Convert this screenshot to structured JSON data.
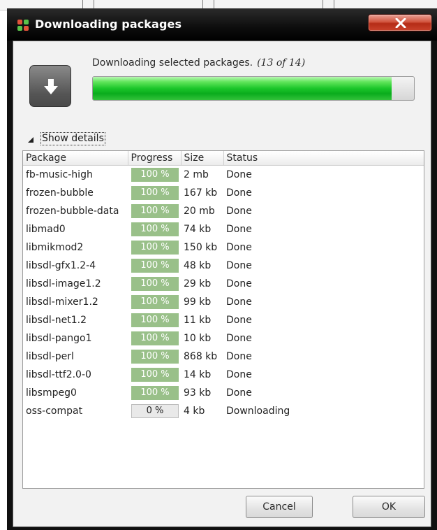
{
  "window": {
    "title": "Downloading packages",
    "close_icon": "close-x-icon",
    "app_icon": "package-manager-icon"
  },
  "header": {
    "icon": "download-arrow-icon",
    "status_text": "Downloading selected packages.",
    "count_text": "(13 of 14)",
    "overall_progress": 0.93
  },
  "details": {
    "toggle_label": "Show details",
    "expanded": true
  },
  "table": {
    "columns": [
      "Package",
      "Progress",
      "Size",
      "Status"
    ],
    "rows": [
      {
        "package": "fb-music-high",
        "progress": "100 %",
        "size": "2 mb",
        "status": "Done"
      },
      {
        "package": "frozen-bubble",
        "progress": "100 %",
        "size": "167 kb",
        "status": "Done"
      },
      {
        "package": "frozen-bubble-data",
        "progress": "100 %",
        "size": "20 mb",
        "status": "Done"
      },
      {
        "package": "libmad0",
        "progress": "100 %",
        "size": "74 kb",
        "status": "Done"
      },
      {
        "package": "libmikmod2",
        "progress": "100 %",
        "size": "150 kb",
        "status": "Done"
      },
      {
        "package": "libsdl-gfx1.2-4",
        "progress": "100 %",
        "size": "48 kb",
        "status": "Done"
      },
      {
        "package": "libsdl-image1.2",
        "progress": "100 %",
        "size": "29 kb",
        "status": "Done"
      },
      {
        "package": "libsdl-mixer1.2",
        "progress": "100 %",
        "size": "99 kb",
        "status": "Done"
      },
      {
        "package": "libsdl-net1.2",
        "progress": "100 %",
        "size": "11 kb",
        "status": "Done"
      },
      {
        "package": "libsdl-pango1",
        "progress": "100 %",
        "size": "10 kb",
        "status": "Done"
      },
      {
        "package": "libsdl-perl",
        "progress": "100 %",
        "size": "868 kb",
        "status": "Done"
      },
      {
        "package": "libsdl-ttf2.0-0",
        "progress": "100 %",
        "size": "14 kb",
        "status": "Done"
      },
      {
        "package": "libsmpeg0",
        "progress": "100 %",
        "size": "93 kb",
        "status": "Done"
      },
      {
        "package": "oss-compat",
        "progress": "0 %",
        "size": "4 kb",
        "status": "Downloading"
      }
    ]
  },
  "buttons": {
    "cancel": "Cancel",
    "ok": "OK"
  },
  "colors": {
    "progress_done": "#99c089",
    "progress_pending": "#e9e9e9",
    "overall_bar": "#1bc62a",
    "close_button": "#c8422a"
  }
}
